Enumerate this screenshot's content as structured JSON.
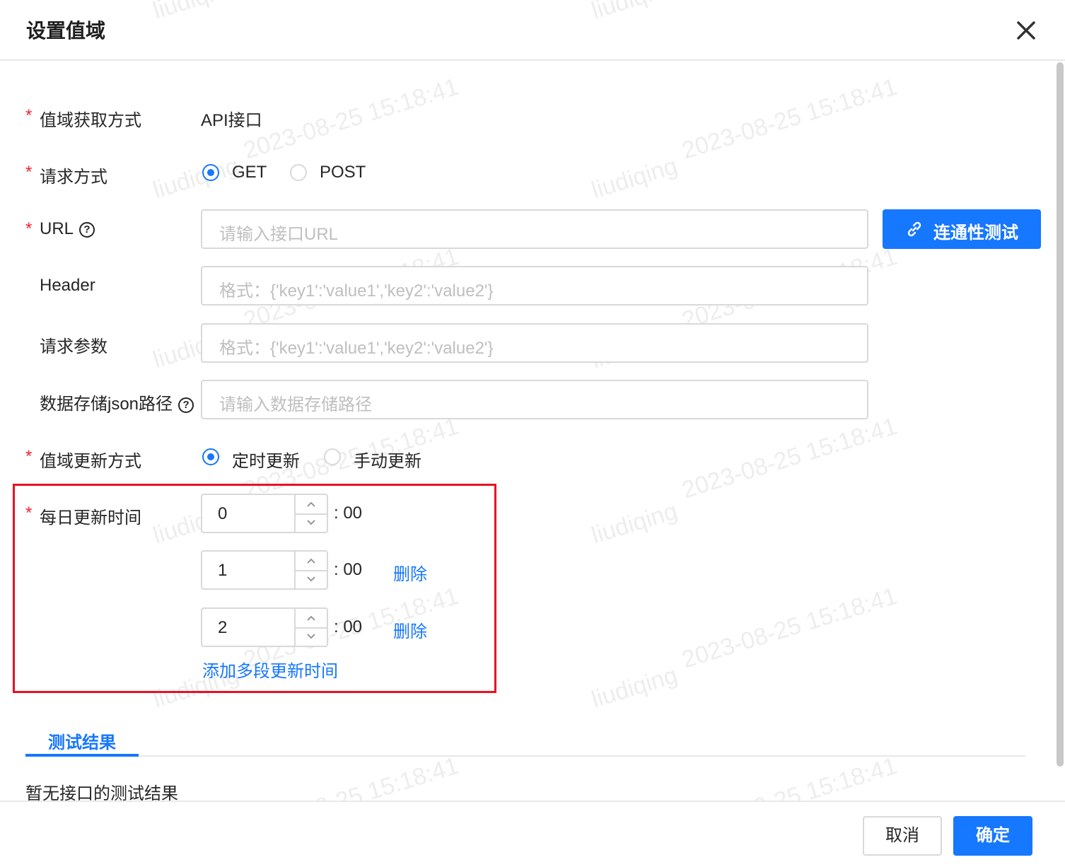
{
  "dialog": {
    "title": "设置值域"
  },
  "form": {
    "source": {
      "label": "值域获取方式",
      "value": "API接口"
    },
    "method": {
      "label": "请求方式",
      "options": [
        "GET",
        "POST"
      ],
      "selected": "GET"
    },
    "url": {
      "label": "URL",
      "placeholder": "请输入接口URL",
      "button": "连通性测试"
    },
    "header": {
      "label": "Header",
      "placeholder": "格式：{'key1':'value1','key2':'value2'}"
    },
    "params": {
      "label": "请求参数",
      "placeholder": "格式：{'key1':'value1','key2':'value2'}"
    },
    "json_path": {
      "label": "数据存储json路径",
      "placeholder": "请输入数据存储路径"
    },
    "update_mode": {
      "label": "值域更新方式",
      "options": [
        "定时更新",
        "手动更新"
      ],
      "selected": "定时更新"
    },
    "update_time": {
      "label": "每日更新时间",
      "entries": [
        {
          "hour": "0",
          "suffix": ": 00"
        },
        {
          "hour": "1",
          "suffix": ": 00",
          "delete": "删除"
        },
        {
          "hour": "2",
          "suffix": ": 00",
          "delete": "删除"
        }
      ],
      "add_link": "添加多段更新时间"
    }
  },
  "result": {
    "tab": "测试结果",
    "empty": "暂无接口的测试结果"
  },
  "footer": {
    "cancel": "取消",
    "ok": "确定"
  },
  "watermark": {
    "user": "liudiqing",
    "datetime": "2023-08-25 15:18:41"
  },
  "colors": {
    "primary": "#1677ff",
    "required": "#f5222d",
    "highlight_box": "#e81123"
  },
  "icons": {
    "close": "close-icon",
    "help": "question-circle-icon",
    "link": "link-icon"
  }
}
